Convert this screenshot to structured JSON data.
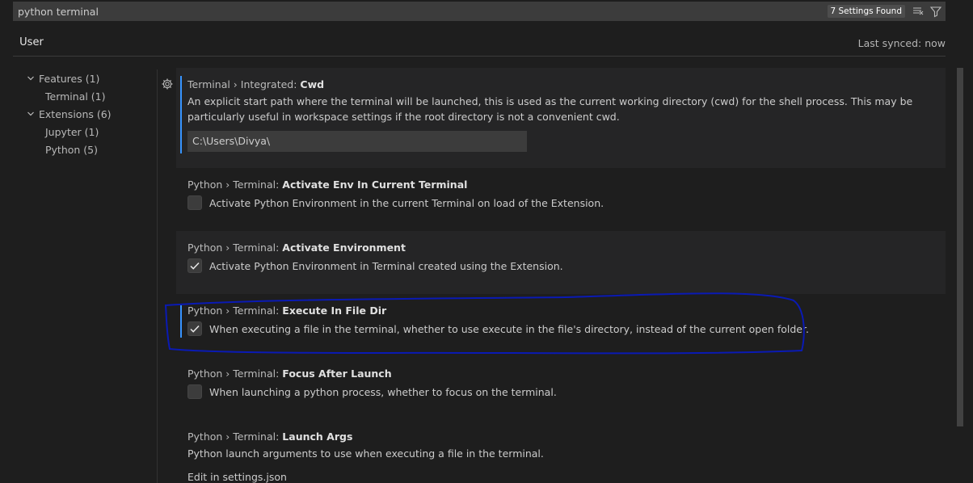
{
  "search": {
    "query": "python terminal",
    "result_count": "7 Settings Found"
  },
  "tabs": {
    "user": "User"
  },
  "sync": {
    "status": "Last synced: now"
  },
  "toc": {
    "items": [
      {
        "label": "Features (1)",
        "level": 0,
        "expanded": true
      },
      {
        "label": "Terminal (1)",
        "level": 1
      },
      {
        "label": "Extensions (6)",
        "level": 0,
        "expanded": true
      },
      {
        "label": "Jupyter (1)",
        "level": 1
      },
      {
        "label": "Python (5)",
        "level": 1
      }
    ]
  },
  "settings": [
    {
      "category": "Terminal › Integrated: ",
      "name": "Cwd",
      "description": "An explicit start path where the terminal will be launched, this is used as the current working directory (cwd) for the shell process. This may be particularly useful in workspace settings if the root directory is not a convenient cwd.",
      "value": "C:\\Users\\Divya\\"
    },
    {
      "category": "Python › Terminal: ",
      "name": "Activate Env In Current Terminal",
      "description": "Activate Python Environment in the current Terminal on load of the Extension.",
      "checked": false
    },
    {
      "category": "Python › Terminal: ",
      "name": "Activate Environment",
      "description": "Activate Python Environment in Terminal created using the Extension.",
      "checked": true
    },
    {
      "category": "Python › Terminal: ",
      "name": "Execute In File Dir",
      "description": "When executing a file in the terminal, whether to use execute in the file's directory, instead of the current open folder.",
      "checked": true
    },
    {
      "category": "Python › Terminal: ",
      "name": "Focus After Launch",
      "description": "When launching a python process, whether to focus on the terminal.",
      "checked": false
    },
    {
      "category": "Python › Terminal: ",
      "name": "Launch Args",
      "description": "Python launch arguments to use when executing a file in the terminal.",
      "link": "Edit in settings.json"
    }
  ],
  "colors": {
    "background": "#1e1e1e",
    "shaded_row": "#252526",
    "input_bg": "#3c3c3c",
    "accent": "#3794ff",
    "annotation": "#0a1ab4"
  }
}
